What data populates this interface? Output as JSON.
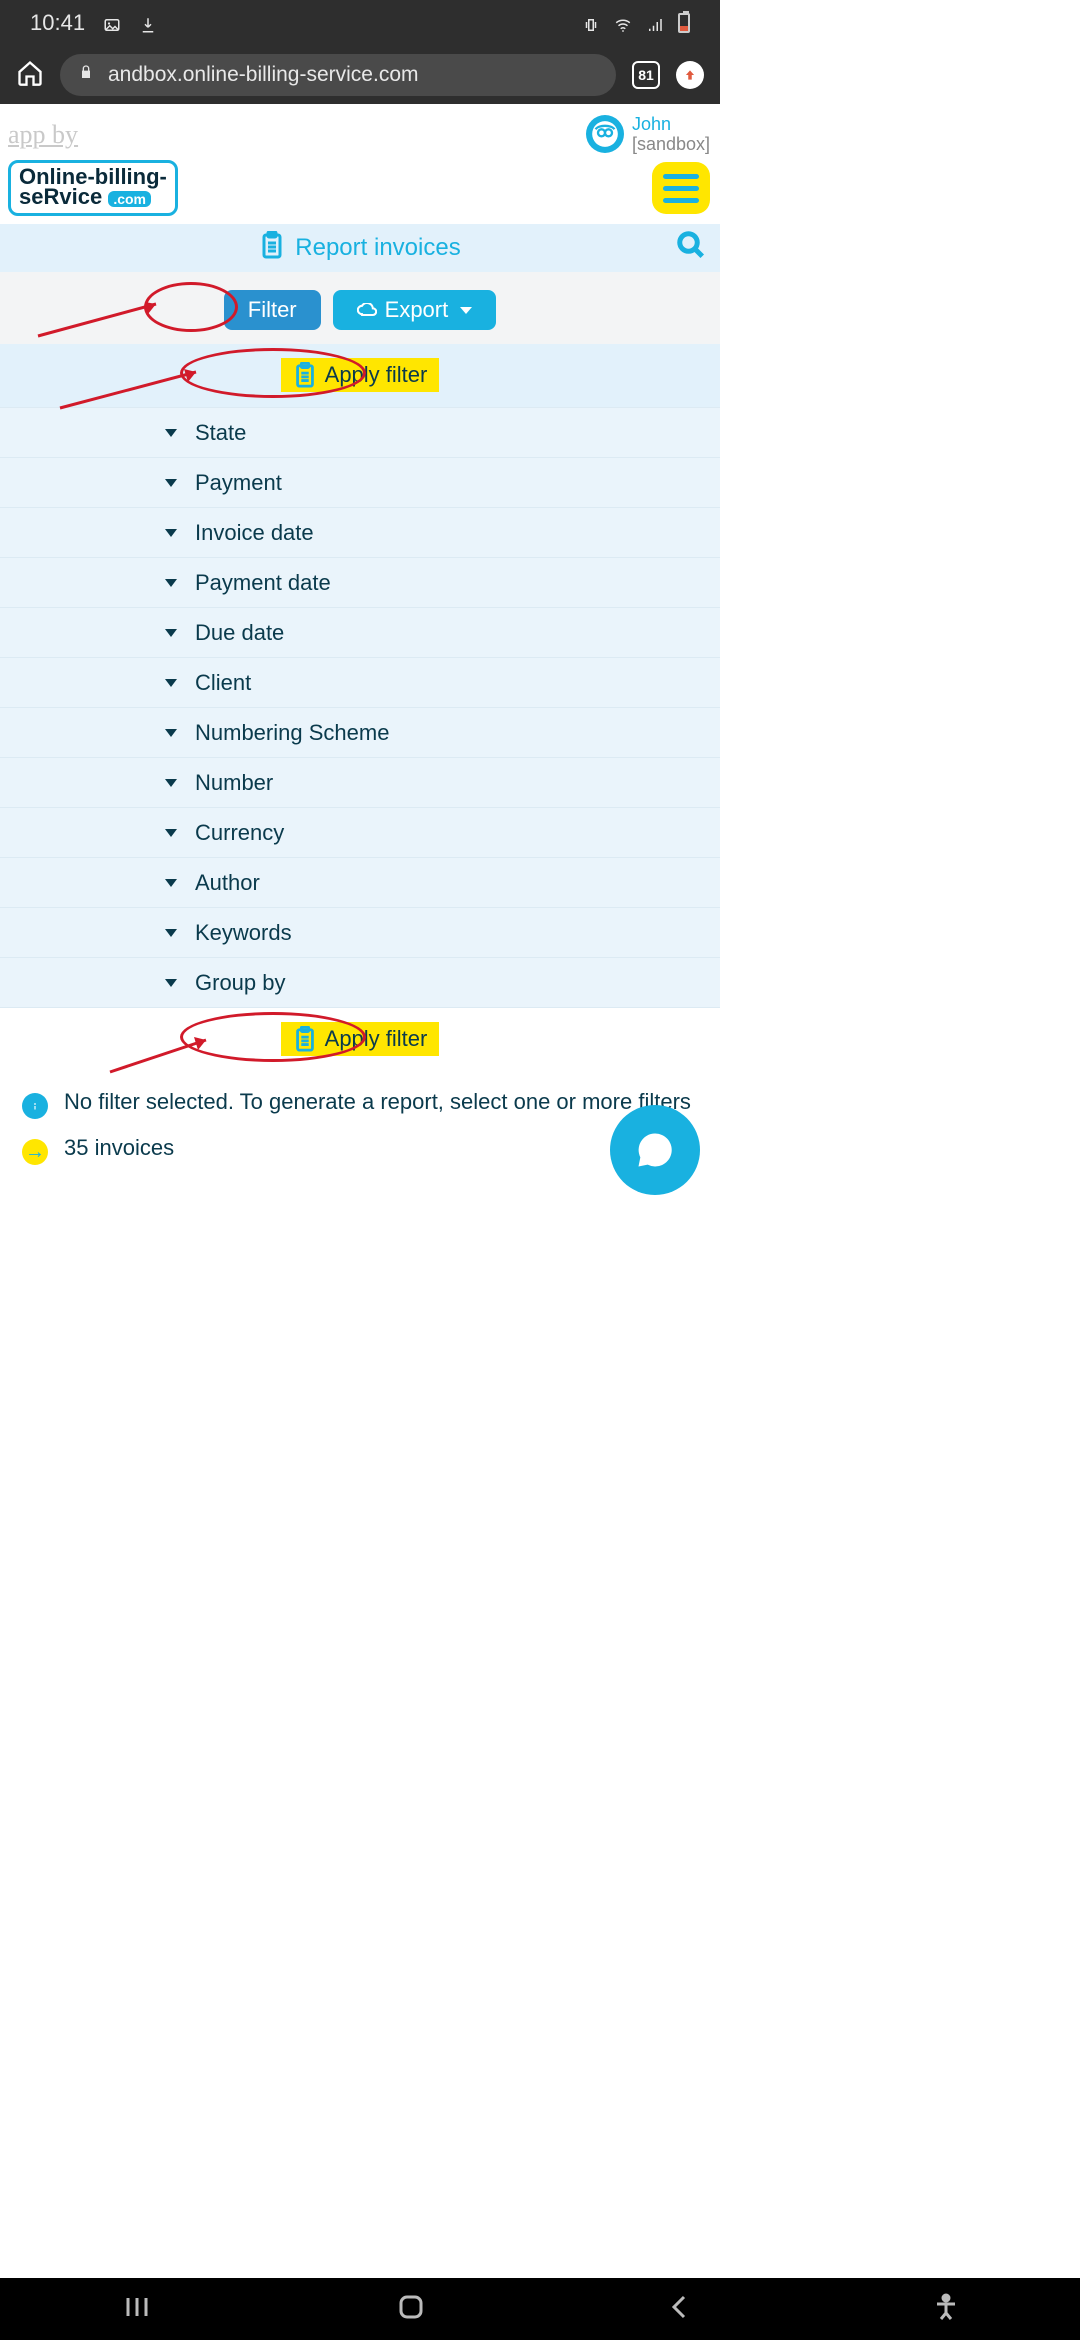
{
  "status": {
    "time": "10:41",
    "tabs": "81"
  },
  "omni": {
    "url": "andbox.online-billing-service.com"
  },
  "header": {
    "appby": "app by",
    "user_name": "John",
    "user_role": "[sandbox]",
    "brand_line1": "Online-billing-",
    "brand_line2": "seRvice",
    "brand_dot": ".com"
  },
  "titleband": {
    "title": "Report invoices"
  },
  "buttons": {
    "filter": "Filter",
    "export": "Export"
  },
  "apply": {
    "label": "Apply filter"
  },
  "filters": {
    "items": [
      "State",
      "Payment",
      "Invoice date",
      "Payment date",
      "Due date",
      "Client",
      "Numbering Scheme",
      "Number",
      "Currency",
      "Author",
      "Keywords",
      "Group by"
    ]
  },
  "info": {
    "no_filter": "No filter selected. To generate a report, select one or more filters",
    "count": "35 invoices"
  }
}
